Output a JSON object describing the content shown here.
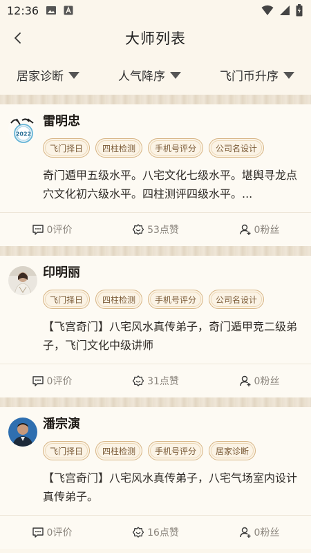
{
  "status": {
    "time": "12:36"
  },
  "header": {
    "title": "大师列表"
  },
  "filters": [
    {
      "label": "居家诊断"
    },
    {
      "label": "人气降序"
    },
    {
      "label": "飞门币升序"
    }
  ],
  "masters": [
    {
      "name": "雷明忠",
      "tags": [
        "飞门择日",
        "四柱检测",
        "手机号评分",
        "公司名设计"
      ],
      "description": "奇门遁甲五级水平。八宅文化七级水平。堪舆寻龙点穴文化初六级水平。四柱测评四级水平。...",
      "reviews": "0评价",
      "likes": "53点赞",
      "fans": "0粉丝",
      "avatar_badge": "2022"
    },
    {
      "name": "印明丽",
      "tags": [
        "飞门择日",
        "四柱检测",
        "手机号评分",
        "公司名设计"
      ],
      "description": "【飞宫奇门】八宅风水真传弟子，奇门遁甲竞二级弟子，飞门文化中级讲师",
      "reviews": "0评价",
      "likes": "31点赞",
      "fans": "0粉丝"
    },
    {
      "name": "潘宗演",
      "tags": [
        "飞门择日",
        "四柱检测",
        "手机号评分",
        "居家诊断"
      ],
      "description": "【飞宫奇门】八宅风水真传弟子，八宅气场室内设计真传弟子。",
      "reviews": "0评价",
      "likes": "16点赞",
      "fans": "0粉丝"
    }
  ]
}
